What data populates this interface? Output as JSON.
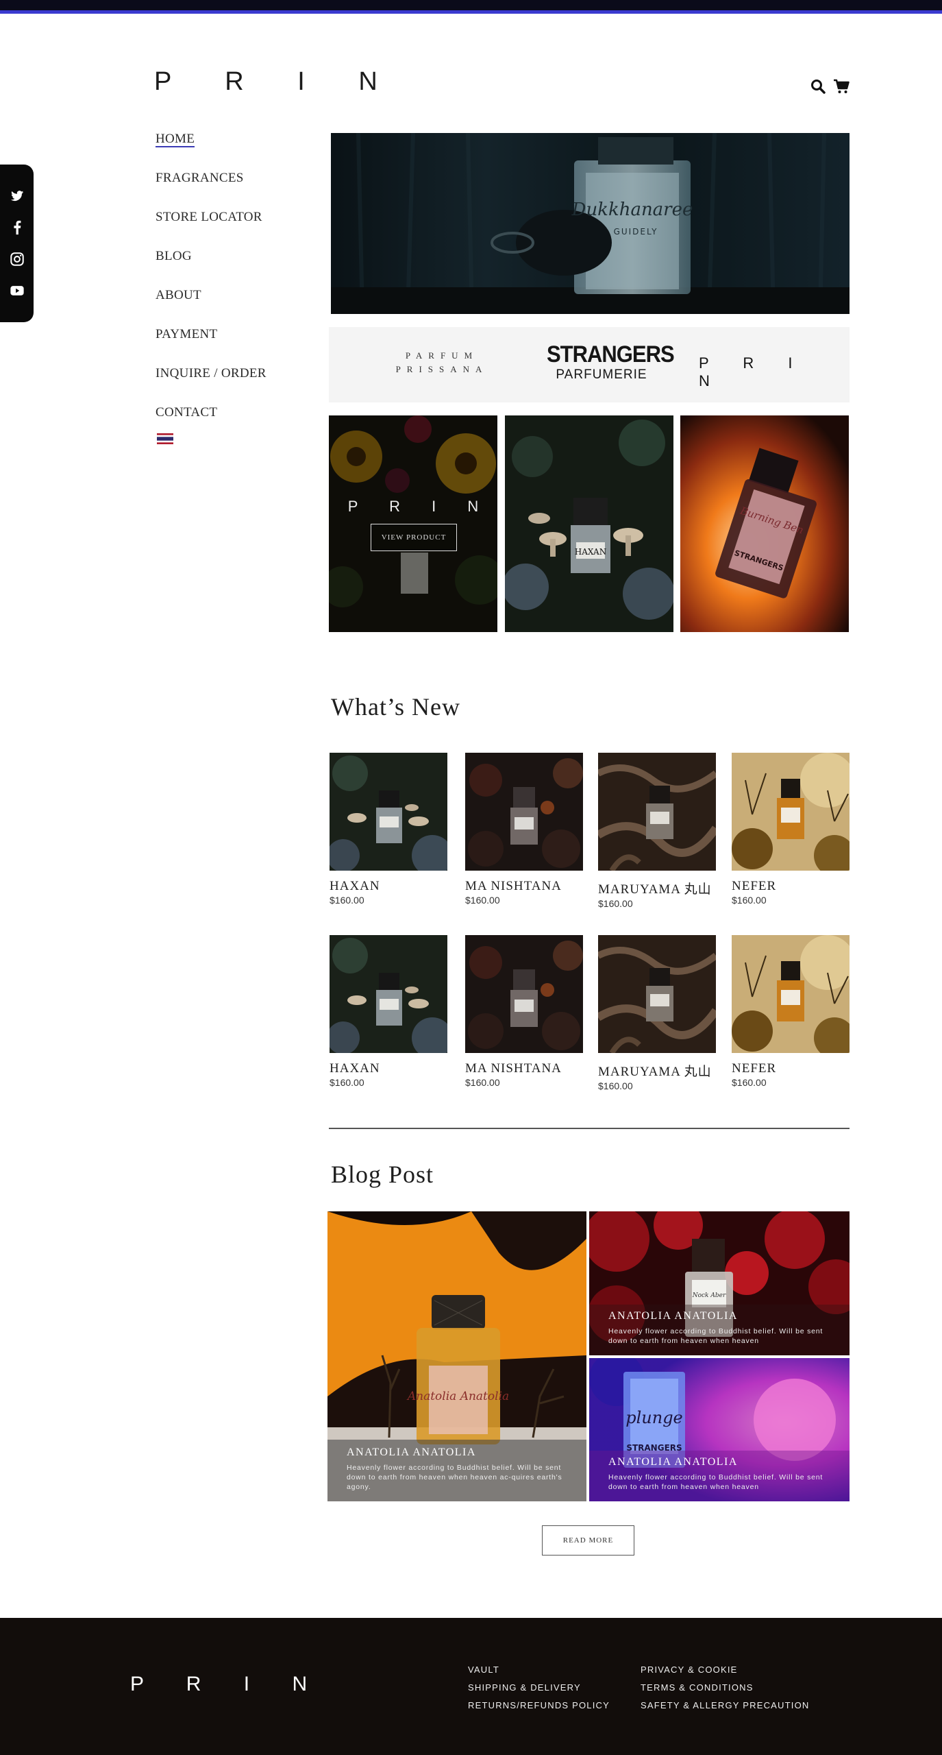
{
  "brand": {
    "logo": "P R I N"
  },
  "header": {
    "icons": [
      "search-icon",
      "cart-icon"
    ]
  },
  "social": {
    "icons": [
      "twitter-icon",
      "facebook-icon",
      "instagram-icon",
      "youtube-icon"
    ]
  },
  "nav": {
    "items": [
      {
        "label": "HOME",
        "active": true
      },
      {
        "label": "FRAGRANCES"
      },
      {
        "label": "STORE LOCATOR"
      },
      {
        "label": "BLOG"
      },
      {
        "label": "ABOUT"
      },
      {
        "label": "PAYMENT"
      },
      {
        "label": "INQUIRE / ORDER"
      },
      {
        "label": "CONTACT"
      }
    ],
    "language_flag": "thai-flag-icon"
  },
  "hero": {
    "bottle_label": "Dukkhanaree",
    "bottle_sub": "GUIDELY"
  },
  "brands": {
    "prissana_line1": "PARFUM",
    "prissana_line2": "PRISSANA",
    "strangers_line1": "STRANGERS",
    "strangers_line2": "PARFUMERIE",
    "prin": "P R I N"
  },
  "tiles": {
    "overlay_logo": "P R I N",
    "view_button": "VIEW PRODUCT",
    "bottle_label_2": "HAXAN",
    "bottle_label_3": "Burning Ben",
    "bottle_brand_3": "STRANGERS"
  },
  "whats_new": {
    "title": "What’s New",
    "row1": [
      {
        "name": "HAXAN",
        "price": "$160.00"
      },
      {
        "name": "MA NISHTANA",
        "price": "$160.00"
      },
      {
        "name": "MARUYAMA 丸山",
        "price": "$160.00"
      },
      {
        "name": "NEFER",
        "price": "$160.00"
      }
    ],
    "row2": [
      {
        "name": "HAXAN",
        "price": "$160.00"
      },
      {
        "name": "MA NISHTANA",
        "price": "$160.00"
      },
      {
        "name": "MARUYAMA 丸山",
        "price": "$160.00"
      },
      {
        "name": "NEFER",
        "price": "$160.00"
      }
    ]
  },
  "blog": {
    "title": "Blog Post",
    "posts": [
      {
        "title": "ANATOLIA ANATOLIA",
        "desc": "Heavenly flower according to Buddhist belief. Will be sent down to earth from heaven when heaven ac-quires earth's agony.",
        "bottle_text": "Anatolia Anatolia"
      },
      {
        "title": "ANATOLIA ANATOLIA",
        "desc": "Heavenly flower according to Buddhist belief. Will be sent down to earth from heaven when heaven",
        "bottle_text": "Nock Aber"
      },
      {
        "title": "ANATOLIA ANATOLIA",
        "desc": "Heavenly flower according to Buddhist belief. Will be sent down to earth from heaven when heaven",
        "bottle_text": "plunge",
        "bottle_brand": "STRANGERS"
      }
    ],
    "read_more": "READ MORE"
  },
  "footer": {
    "logo": "P R I N",
    "col1": [
      "VAULT",
      "SHIPPING & DELIVERY",
      "RETURNS/REFUNDS POLICY"
    ],
    "col2": [
      "PRIVACY & COOKIE",
      "TERMS & CONDITIONS",
      "SAFETY & ALLERGY PRECAUTION"
    ]
  },
  "colors": {
    "accent": "#3b3bb5",
    "footer_bg": "#120d0b",
    "brandbar_bg": "#f4f4f4",
    "topbar": "#0b0b1a"
  }
}
